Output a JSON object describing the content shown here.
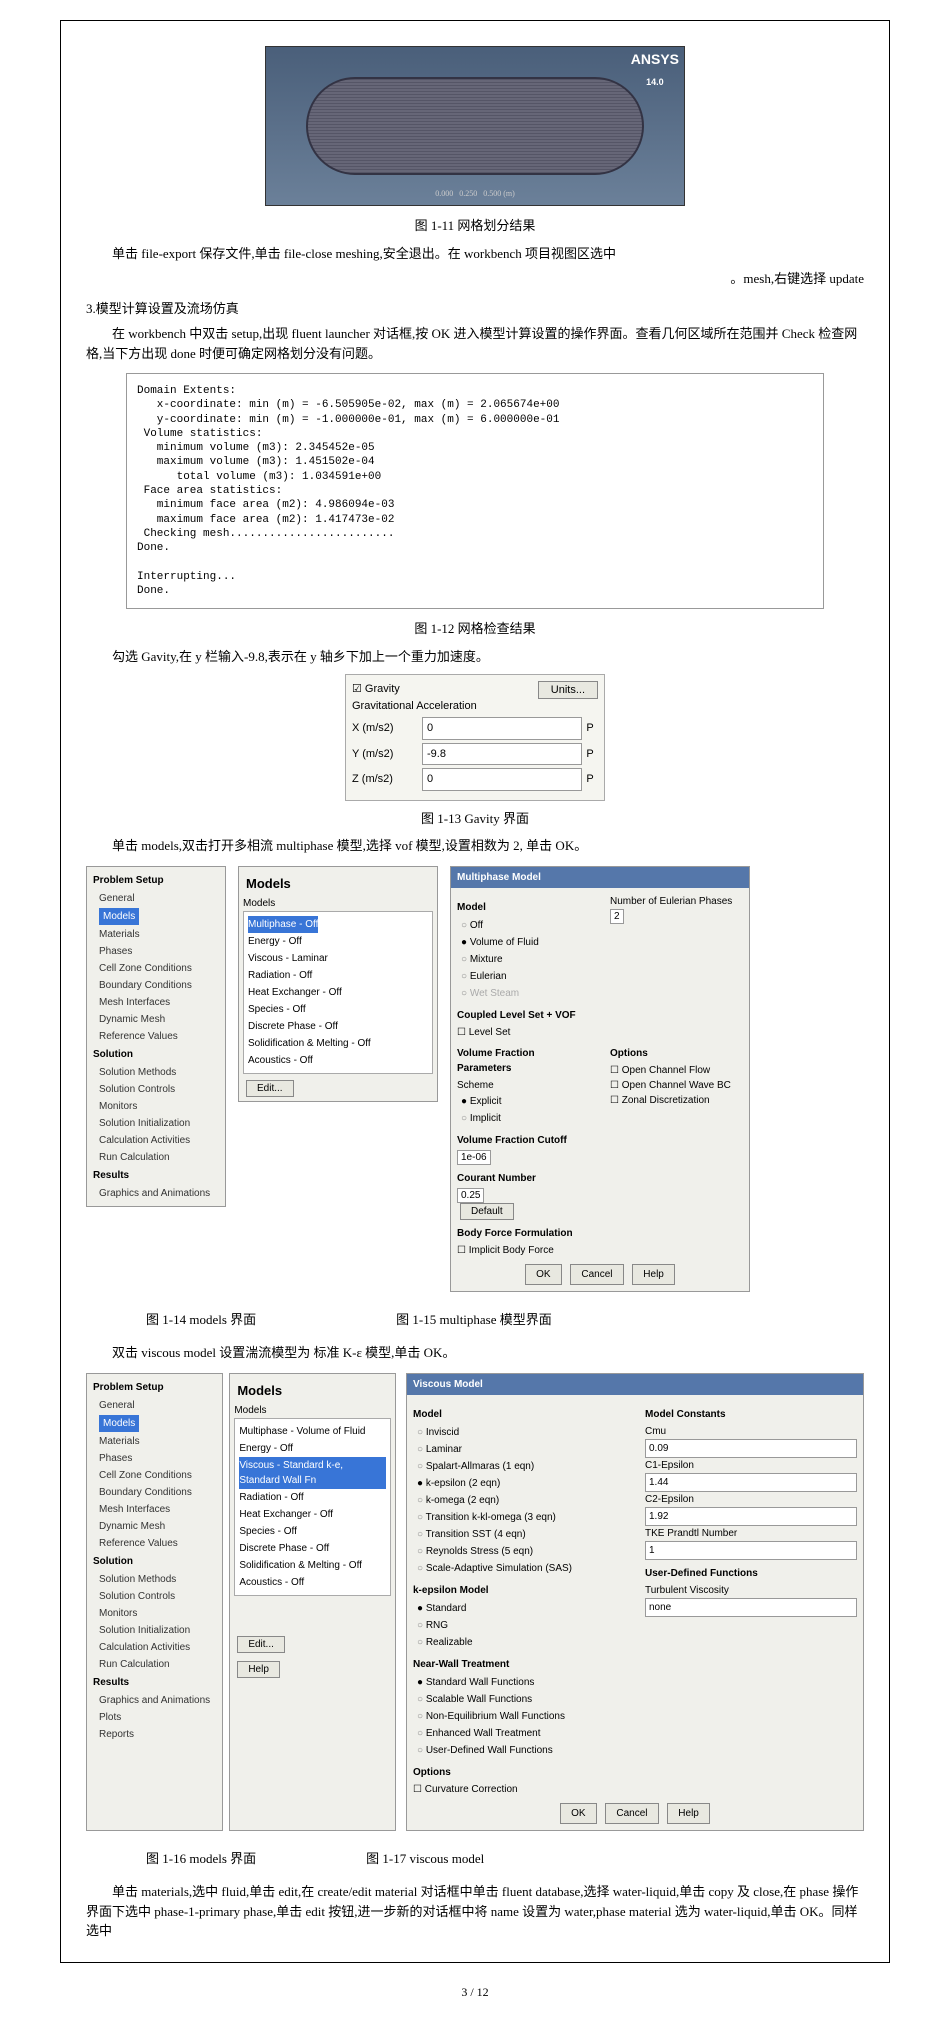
{
  "ansys_logo": "ANSYS",
  "ansys_ver": "14.0",
  "caption_1_11": "图 1-11 网格划分结果",
  "para_1": "单击 file-export 保存文件,单击 file-close meshing,安全退出。在 workbench 项目视图区选中",
  "para_1b": "。mesh,右键选择 update",
  "heading_3": "3.模型计算设置及流场仿真",
  "para_2": "在 workbench 中双击 setup,出现 fluent launcher 对话框,按 OK 进入模型计算设置的操作界面。查看几何区域所在范围并 Check 检查网格,当下方出现 done 时便可确定网格划分没有问题。",
  "console": "Domain Extents:\n   x-coordinate: min (m) = -6.505905e-02, max (m) = 2.065674e+00\n   y-coordinate: min (m) = -1.000000e-01, max (m) = 6.000000e-01\n Volume statistics:\n   minimum volume (m3): 2.345452e-05\n   maximum volume (m3): 1.451502e-04\n      total volume (m3): 1.034591e+00\n Face area statistics:\n   minimum face area (m2): 4.986094e-03\n   maximum face area (m2): 1.417473e-02\n Checking mesh.........................\nDone.\n\nInterrupting...\nDone.",
  "caption_1_12": "图 1-12 网格检查结果",
  "para_3": "勾选 Gavity,在 y 栏输入-9.8,表示在 y 轴乡下加上一个重力加速度。",
  "gravity": {
    "check_label": "Gravity",
    "units_btn": "Units...",
    "accel_label": "Gravitational Acceleration",
    "x_label": "X (m/s2)",
    "x_val": "0",
    "y_label": "Y (m/s2)",
    "y_val": "-9.8",
    "z_label": "Z (m/s2)",
    "z_val": "0"
  },
  "caption_1_13": "图 1-13 Gavity 界面",
  "para_4": "单击 models,双击打开多相流 multiphase 模型,选择 vof 模型,设置相数为 2, 单击 OK。",
  "tree": {
    "header": "Problem Setup",
    "items": [
      "General",
      "Models",
      "Materials",
      "Phases",
      "Cell Zone Conditions",
      "Boundary Conditions",
      "Mesh Interfaces",
      "Dynamic Mesh",
      "Reference Values"
    ],
    "sol_header": "Solution",
    "sol_items": [
      "Solution Methods",
      "Solution Controls",
      "Monitors",
      "Solution Initialization",
      "Calculation Activities",
      "Run Calculation"
    ],
    "res_header": "Results",
    "res_items": [
      "Graphics and Animations"
    ]
  },
  "models_panel": {
    "title": "Models",
    "subtitle": "Models",
    "items": [
      "Multiphase - Off",
      "Energy - Off",
      "Viscous - Laminar",
      "Radiation - Off",
      "Heat Exchanger - Off",
      "Species - Off",
      "Discrete Phase - Off",
      "Solidification & Melting - Off",
      "Acoustics - Off"
    ],
    "edit_btn": "Edit..."
  },
  "multiphase_dialog": {
    "title": "Multiphase Model",
    "model_hdr": "Model",
    "model_opts": [
      "Off",
      "Volume of Fluid",
      "Mixture",
      "Eulerian",
      "Wet Steam"
    ],
    "phases_label": "Number of Eulerian Phases",
    "phases_val": "2",
    "coupled_label": "Coupled Level Set + VOF",
    "level_set": "Level Set",
    "vfp_hdr": "Volume Fraction Parameters",
    "scheme_hdr": "Scheme",
    "scheme_opts": [
      "Explicit",
      "Implicit"
    ],
    "options_hdr": "Options",
    "opt1": "Open Channel Flow",
    "opt2": "Open Channel Wave BC",
    "opt3": "Zonal Discretization",
    "vfc_hdr": "Volume Fraction Cutoff",
    "vfc_val": "1e-06",
    "courant_hdr": "Courant Number",
    "courant_val": "0.25",
    "default_btn": "Default",
    "bff_hdr": "Body Force Formulation",
    "bff_item": "Implicit Body Force",
    "ok": "OK",
    "cancel": "Cancel",
    "help": "Help"
  },
  "caption_1_14": "图 1-14 models 界面",
  "caption_1_15": "图 1-15 multiphase 模型界面",
  "para_5": "双击 viscous model 设置湍流模型为 标准 K-ε 模型,单击 OK。",
  "tree2": {
    "header": "Problem Setup",
    "items": [
      "General",
      "Models",
      "Materials",
      "Phases",
      "Cell Zone Conditions",
      "Boundary Conditions",
      "Mesh Interfaces",
      "Dynamic Mesh",
      "Reference Values"
    ],
    "sol_header": "Solution",
    "sol_items": [
      "Solution Methods",
      "Solution Controls",
      "Monitors",
      "Solution Initialization",
      "Calculation Activities",
      "Run Calculation"
    ],
    "res_header": "Results",
    "res_items": [
      "Graphics and Animations",
      "Plots",
      "Reports"
    ]
  },
  "models_panel2": {
    "title": "Models",
    "subtitle": "Models",
    "items": [
      "Multiphase - Volume of Fluid",
      "Energy - Off",
      "Viscous - Standard k-e, Standard Wall Fn",
      "Radiation - Off",
      "Heat Exchanger - Off",
      "Species - Off",
      "Discrete Phase - Off",
      "Solidification & Melting - Off",
      "Acoustics - Off"
    ],
    "edit_btn": "Edit...",
    "help_btn": "Help"
  },
  "viscous_dialog": {
    "title": "Viscous Model",
    "model_hdr": "Model",
    "model_opts": [
      "Inviscid",
      "Laminar",
      "Spalart-Allmaras (1 eqn)",
      "k-epsilon (2 eqn)",
      "k-omega (2 eqn)",
      "Transition k-kl-omega (3 eqn)",
      "Transition SST (4 eqn)",
      "Reynolds Stress (5 eqn)",
      "Scale-Adaptive Simulation (SAS)"
    ],
    "kem_hdr": "k-epsilon Model",
    "kem_opts": [
      "Standard",
      "RNG",
      "Realizable"
    ],
    "nwt_hdr": "Near-Wall Treatment",
    "nwt_opts": [
      "Standard Wall Functions",
      "Scalable Wall Functions",
      "Non-Equilibrium Wall Functions",
      "Enhanced Wall Treatment",
      "User-Defined Wall Functions"
    ],
    "opts_hdr": "Options",
    "opts_item": "Curvature Correction",
    "const_hdr": "Model Constants",
    "cmu_lbl": "Cmu",
    "cmu_val": "0.09",
    "c1e_lbl": "C1-Epsilon",
    "c1e_val": "1.44",
    "c2e_lbl": "C2-Epsilon",
    "c2e_val": "1.92",
    "tkepr_lbl": "TKE Prandtl Number",
    "tkepr_val": "1",
    "udf_hdr": "User-Defined Functions",
    "turb_visc_lbl": "Turbulent Viscosity",
    "turb_visc_val": "none",
    "ok": "OK",
    "cancel": "Cancel",
    "help": "Help"
  },
  "caption_1_16": "图 1-16 models 界面",
  "caption_1_17": "图 1-17 viscous model",
  "para_6": "单击 materials,选中 fluid,单击 edit,在 create/edit material 对话框中单击 fluent database,选择 water-liquid,单击 copy 及 close,在 phase 操作界面下选中 phase-1-primary phase,单击 edit 按钮,进一步新的对话框中将 name 设置为 water,phase material 选为 water-liquid,单击 OK。同样选中",
  "page_num": "3 / 12"
}
